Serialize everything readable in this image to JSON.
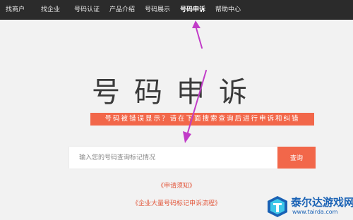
{
  "nav": {
    "items": [
      {
        "label": "找商户"
      },
      {
        "label": "找企业"
      },
      {
        "label": "号码认证"
      },
      {
        "label": "产品介绍"
      },
      {
        "label": "号码展示"
      },
      {
        "label": "号码申诉",
        "active": true
      },
      {
        "label": "帮助中心"
      }
    ]
  },
  "main": {
    "title": "号码申诉",
    "subtitle": "号码被错误显示？请在下面搜索查询后进行申诉和纠错",
    "search": {
      "placeholder": "输入您的号码查询标记情况",
      "button_label": "查询"
    },
    "links": {
      "apply_notice": "《申请须知》",
      "process": "《企业大量号码标记申诉流程》"
    }
  },
  "watermark": {
    "name": "泰尔达游戏网",
    "url": "www.tairda.com"
  },
  "colors": {
    "accent": "#f2674a",
    "nav_bg": "#2b2b2b",
    "annotation_arrow": "#c13cc8",
    "watermark_blue": "#1a62b5"
  }
}
